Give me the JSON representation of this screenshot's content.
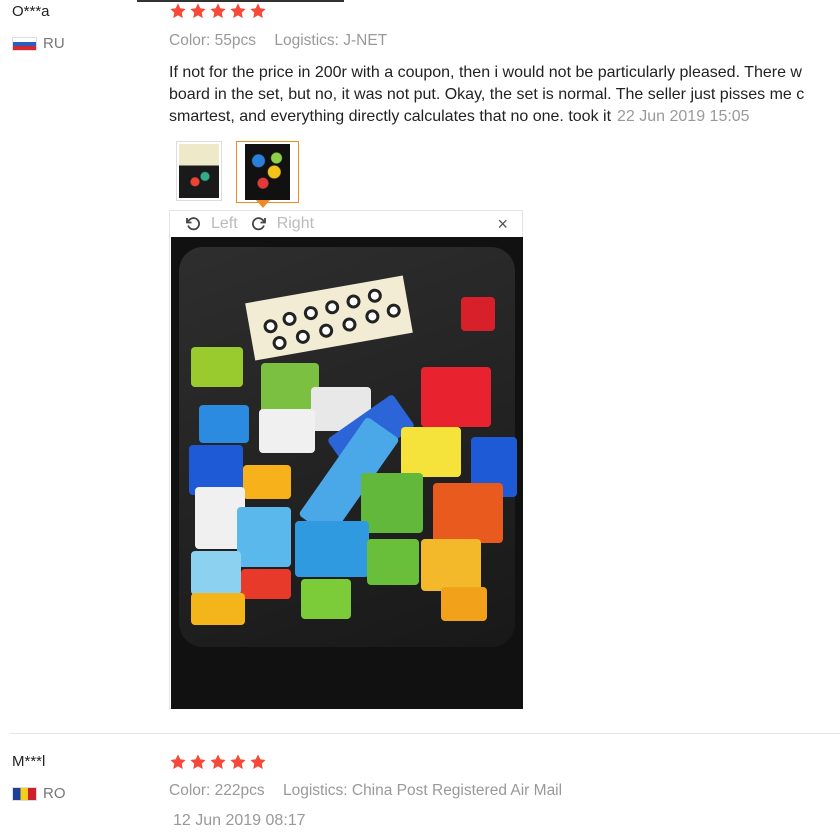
{
  "reviews": [
    {
      "user": "O***a",
      "country": "RU",
      "stars": 5,
      "color": "Color: 55pcs",
      "logistics": "Logistics: J-NET",
      "text_lines": [
        "If not for the price in 200r with a coupon, then i would not be particularly pleased. There w",
        "board in the set, but no, it was not put. Okay, the set is normal. The seller just pisses me c",
        "smartest, and everything directly calculates that no one. took it"
      ],
      "date": "22 Jun 2019 15:05",
      "viewer": {
        "rotate_left": "Left",
        "rotate_right": "Right",
        "close": "×"
      }
    },
    {
      "user": "M***l",
      "country": "RO",
      "stars": 5,
      "color": "Color: 222pcs",
      "logistics": "Logistics: China Post Registered Air Mail",
      "date": "12 Jun 2019 08:17"
    }
  ],
  "colors": {
    "star": "#f54a3a",
    "accent": "#f08a24",
    "muted": "#999999"
  }
}
